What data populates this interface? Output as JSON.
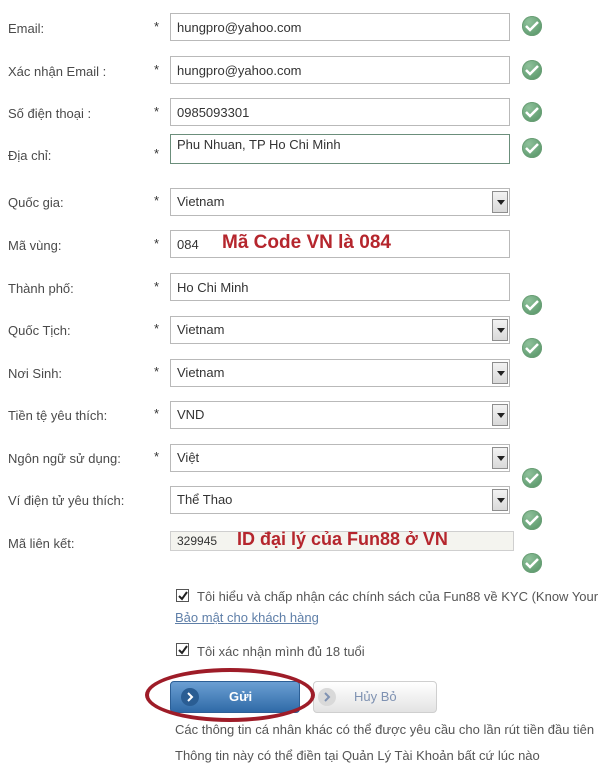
{
  "form": {
    "fields": [
      {
        "label": "Email:",
        "value": "hungpro@yahoo.com",
        "type": "text"
      },
      {
        "label": "Xác nhận Email :",
        "value": "hungpro@yahoo.com",
        "type": "text"
      },
      {
        "label": "Số điện thoại :",
        "value": "0985093301",
        "type": "text"
      },
      {
        "label": "Địa chỉ:",
        "value": "Phu Nhuan, TP Ho Chi Minh",
        "type": "textarea"
      },
      {
        "label": "Quốc gia:",
        "value": "Vietnam",
        "type": "select"
      },
      {
        "label": "Mã vùng:",
        "value": "084",
        "type": "text"
      },
      {
        "label": "Thành phố:",
        "value": "Ho Chi Minh",
        "type": "text"
      },
      {
        "label": "Quốc Tịch:",
        "value": "Vietnam",
        "type": "select"
      },
      {
        "label": "Nơi Sinh:",
        "value": "Vietnam",
        "type": "select"
      },
      {
        "label": "Tiền tệ yêu thích:",
        "value": "VND",
        "type": "select"
      },
      {
        "label": "Ngôn ngữ sử dụng:",
        "value": "Việt",
        "type": "select"
      },
      {
        "label": "Ví điện tử yêu thích:",
        "value": "Thể Thao",
        "type": "select"
      },
      {
        "label": "Mã liên kết:",
        "value": "329945",
        "type": "text"
      }
    ],
    "required_mark": "*"
  },
  "annotations": {
    "area_code": "Mã Code VN là 084",
    "agent_id": "ID đại lý của Fun88 ở VN"
  },
  "agreements": {
    "kyc_text": "Tôi hiểu và chấp nhận các chính sách của Fun88 về KYC (Know Your",
    "privacy_link": "Bảo mật cho khách hàng",
    "age_text": "Tôi xác nhận mình đủ 18 tuổi",
    "kyc_checked": true,
    "age_checked": true
  },
  "buttons": {
    "submit_label": "Gửi",
    "cancel_label": "Hủy Bỏ"
  },
  "footer": {
    "line1": "Các thông tin cá nhân khác có thể được yêu cầu cho lần rút tiền đầu tiên",
    "line2": "Thông tin này có thể điền tại Quản Lý Tài Khoản bất cứ lúc nào"
  },
  "colors": {
    "check_green": "#4f8f60",
    "annotation_red": "#b5262d",
    "button_blue": "#2f6aa7"
  }
}
